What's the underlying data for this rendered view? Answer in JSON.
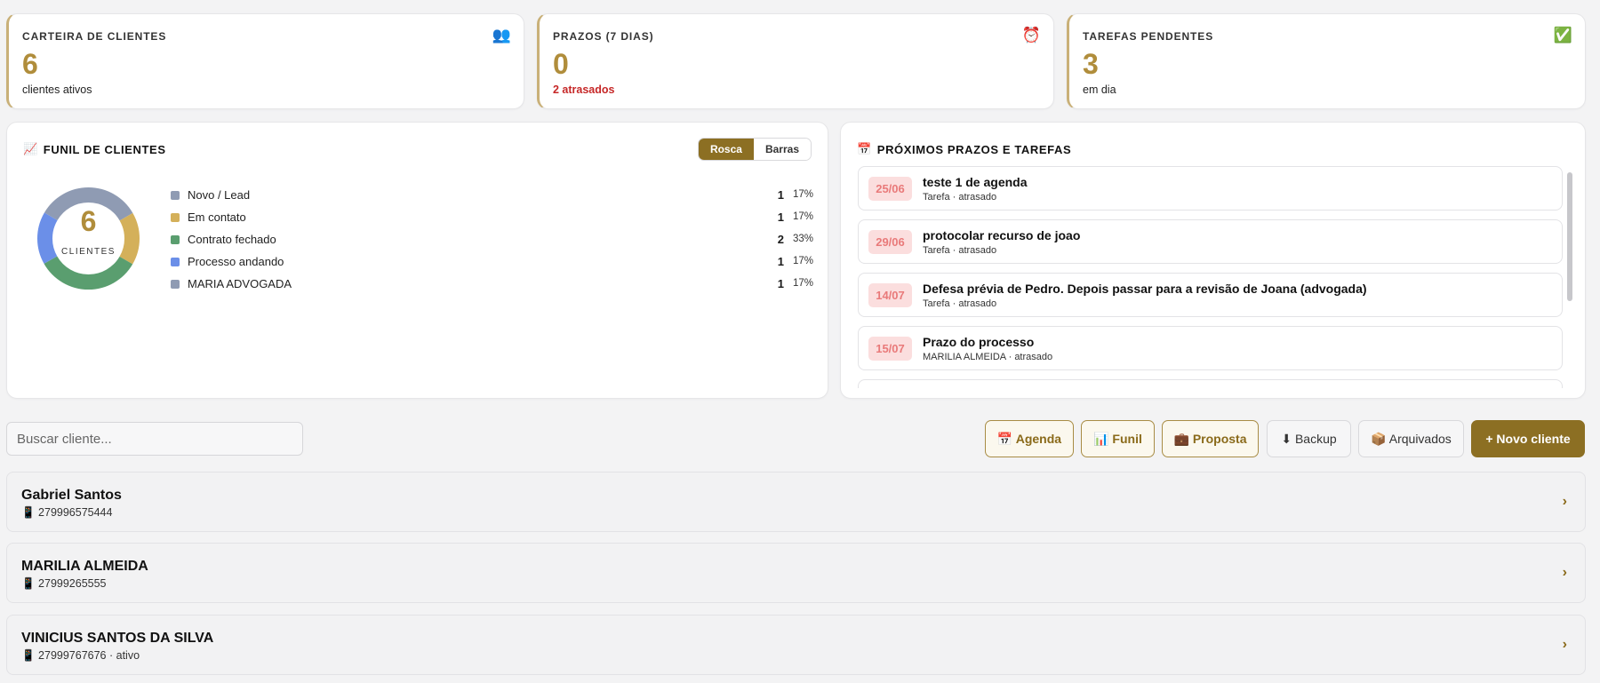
{
  "kpis": [
    {
      "title": "CARTEIRA DE CLIENTES",
      "icon": "people-icon",
      "glyph": "👥",
      "value": "6",
      "sub": "clientes ativos"
    },
    {
      "title": "PRAZOS (7 DIAS)",
      "icon": "alarm-clock-icon",
      "glyph": "⏰",
      "value": "0",
      "sub": "2 atrasados"
    },
    {
      "title": "TAREFAS PENDENTES",
      "icon": "check-icon",
      "glyph": "✅",
      "value": "3",
      "sub": "em dia"
    }
  ],
  "funnel": {
    "title": "FUNIL DE CLIENTES",
    "icon": "chart-icon",
    "glyph": "📈",
    "toggle": {
      "donut": "Rosca",
      "bars": "Barras",
      "selected": "Rosca"
    },
    "center_value": "6",
    "center_label": "CLIENTES",
    "stages": [
      {
        "name": "Novo / Lead",
        "count": "1",
        "pct": "17%",
        "color": "#8f9bb3"
      },
      {
        "name": "Em contato",
        "count": "1",
        "pct": "17%",
        "color": "#d4b05a"
      },
      {
        "name": "Contrato fechado",
        "count": "2",
        "pct": "33%",
        "color": "#5a9e6f"
      },
      {
        "name": "Processo andando",
        "count": "1",
        "pct": "17%",
        "color": "#6b8fe8"
      },
      {
        "name": "MARIA ADVOGADA",
        "count": "1",
        "pct": "17%",
        "color": "#8f9bb3"
      }
    ]
  },
  "deadlines": {
    "title": "PRÓXIMOS PRAZOS E TAREFAS",
    "icon": "calendar-icon",
    "glyph": "📅",
    "items": [
      {
        "date": "25/06",
        "title": "teste 1 de agenda",
        "sub": "Tarefa · atrasado"
      },
      {
        "date": "29/06",
        "title": "protocolar recurso de joao",
        "sub": "Tarefa · atrasado"
      },
      {
        "date": "14/07",
        "title": "Defesa prévia de Pedro. Depois passar para a revisão de Joana (advogada)",
        "sub": "Tarefa · atrasado"
      },
      {
        "date": "15/07",
        "title": "Prazo do processo",
        "sub": "MARILIA ALMEIDA · atrasado"
      }
    ]
  },
  "toolbar": {
    "search_placeholder": "Buscar cliente...",
    "agenda": "📅 Agenda",
    "funil": "📊 Funil",
    "proposta": "💼 Proposta",
    "backup": "⬇ Backup",
    "arquivados": "📦 Arquivados",
    "novo": "+ Novo cliente"
  },
  "clients": [
    {
      "name": "Gabriel Santos",
      "phone": "📱 279996575444"
    },
    {
      "name": "MARILIA ALMEIDA",
      "phone": "📱 27999265555"
    },
    {
      "name": "VINICIUS SANTOS DA SILVA",
      "phone": "📱 27999767676 · ativo"
    }
  ]
}
